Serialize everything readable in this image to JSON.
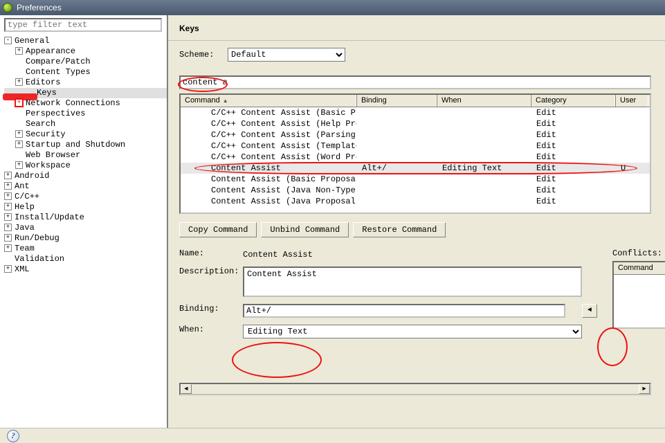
{
  "window": {
    "title": "Preferences"
  },
  "filter_placeholder": "type filter text",
  "tree": [
    {
      "label": "General",
      "expand": "-",
      "level": 0,
      "items": [
        {
          "label": "Appearance",
          "expand": "+",
          "level": 1
        },
        {
          "label": "Compare/Patch",
          "expand": "",
          "level": 1
        },
        {
          "label": "Content Types",
          "expand": "",
          "level": 1
        },
        {
          "label": "Editors",
          "expand": "+",
          "level": 1
        },
        {
          "label": "Keys",
          "expand": "",
          "level": 2,
          "selected": true,
          "redmark": true
        },
        {
          "label": "Network Connections",
          "expand": "+",
          "level": 1,
          "redplus": true
        },
        {
          "label": "Perspectives",
          "expand": "",
          "level": 1
        },
        {
          "label": "Search",
          "expand": "",
          "level": 1
        },
        {
          "label": "Security",
          "expand": "+",
          "level": 1
        },
        {
          "label": "Startup and Shutdown",
          "expand": "+",
          "level": 1
        },
        {
          "label": "Web Browser",
          "expand": "",
          "level": 1
        },
        {
          "label": "Workspace",
          "expand": "+",
          "level": 1
        }
      ]
    },
    {
      "label": "Android",
      "expand": "+",
      "level": 0
    },
    {
      "label": "Ant",
      "expand": "+",
      "level": 0
    },
    {
      "label": "C/C++",
      "expand": "+",
      "level": 0
    },
    {
      "label": "Help",
      "expand": "+",
      "level": 0
    },
    {
      "label": "Install/Update",
      "expand": "+",
      "level": 0
    },
    {
      "label": "Java",
      "expand": "+",
      "level": 0
    },
    {
      "label": "Run/Debug",
      "expand": "+",
      "level": 0
    },
    {
      "label": "Team",
      "expand": "+",
      "level": 0
    },
    {
      "label": "Validation",
      "expand": "",
      "level": 0
    },
    {
      "label": "XML",
      "expand": "+",
      "level": 0
    }
  ],
  "page": {
    "title": "Keys",
    "scheme_label": "Scheme:",
    "scheme_value": "Default",
    "filter_value": "content a",
    "columns": {
      "command": "Command",
      "binding": "Binding",
      "when": "When",
      "category": "Category",
      "user": "User"
    },
    "rows": [
      {
        "command": "C/C++ Content Assist (Basic Propo",
        "binding": "",
        "when": "",
        "category": "Edit",
        "user": ""
      },
      {
        "command": "C/C++ Content Assist (Help Propos",
        "binding": "",
        "when": "",
        "category": "Edit",
        "user": ""
      },
      {
        "command": "C/C++ Content Assist (Parsing-bas",
        "binding": "",
        "when": "",
        "category": "Edit",
        "user": ""
      },
      {
        "command": "C/C++ Content Assist (Template Pr",
        "binding": "",
        "when": "",
        "category": "Edit",
        "user": ""
      },
      {
        "command": "C/C++ Content Assist (Word Propos",
        "binding": "",
        "when": "",
        "category": "Edit",
        "user": ""
      },
      {
        "command": "Content Assist",
        "binding": "Alt+/",
        "when": "Editing Text",
        "category": "Edit",
        "user": "U",
        "selected": true
      },
      {
        "command": "Content Assist (Basic Proposals)",
        "binding": "",
        "when": "",
        "category": "Edit",
        "user": ""
      },
      {
        "command": "Content Assist (Java Non-Type Pro",
        "binding": "",
        "when": "",
        "category": "Edit",
        "user": ""
      },
      {
        "command": "Content Assist (Java Proposals)",
        "binding": "",
        "when": "",
        "category": "Edit",
        "user": ""
      }
    ],
    "buttons": {
      "copy": "Copy Command",
      "unbind": "Unbind Command",
      "restore": "Restore Command"
    },
    "detail": {
      "name_label": "Name:",
      "name_value": "Content Assist",
      "desc_label": "Description:",
      "desc_value": "Content Assist",
      "binding_label": "Binding:",
      "binding_value": "Alt+/",
      "when_label": "When:",
      "when_value": "Editing Text"
    },
    "conflicts": {
      "label": "Conflicts:",
      "col": "Command"
    }
  }
}
